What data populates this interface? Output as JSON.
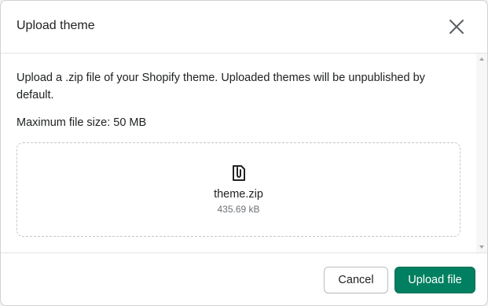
{
  "modal": {
    "title": "Upload theme",
    "close_icon": "close-icon"
  },
  "body": {
    "description": "Upload a .zip file of your Shopify theme. Uploaded themes will be unpublished by default.",
    "max_size": "Maximum file size: 50 MB"
  },
  "file": {
    "icon": "paperclip-file-icon",
    "name": "theme.zip",
    "size": "435.69 kB"
  },
  "footer": {
    "cancel_label": "Cancel",
    "upload_label": "Upload file"
  },
  "colors": {
    "primary": "#008060",
    "text": "#202223",
    "subdued": "#6d7175"
  }
}
